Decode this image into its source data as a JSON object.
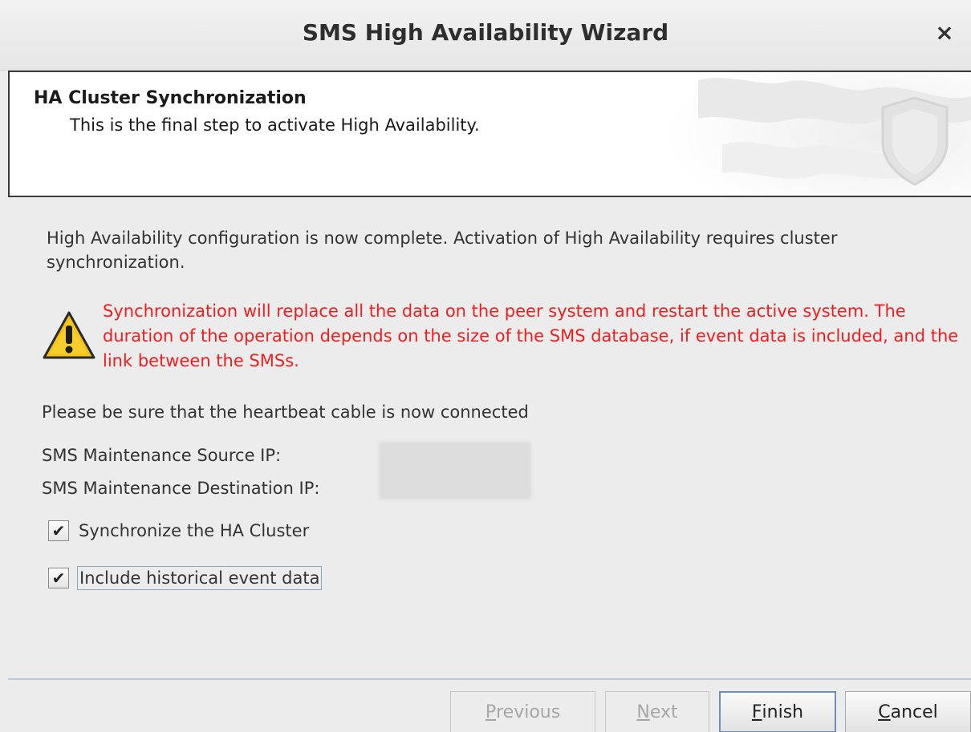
{
  "window": {
    "title": "SMS High Availability Wizard",
    "close_symbol": "×"
  },
  "header": {
    "heading": "HA Cluster Synchronization",
    "subheading": "This is the final step to activate High Availability."
  },
  "body": {
    "intro": "High Availability configuration is now complete.  Activation of High Availability requires cluster synchronization.",
    "warning_icon": "warning-triangle-icon",
    "warning": "Synchronization will replace all the data on the peer system and restart the active system.  The duration of the operation depends on the size of the SMS database, if event data is included, and the link between the SMSs.",
    "warning_color": "#f01e1e",
    "heartbeat_note": "Please be sure that the heartbeat cable is now connected",
    "source_ip_label": "SMS Maintenance Source IP:",
    "destination_ip_label": "SMS Maintenance Destination IP:"
  },
  "options": [
    {
      "label": "Synchronize the HA Cluster",
      "checked": true
    },
    {
      "label": "Include historical event data",
      "checked": true
    }
  ],
  "buttons": {
    "previous": {
      "mnemonic": "P",
      "rest": "revious",
      "enabled": false
    },
    "next": {
      "mnemonic": "N",
      "rest": "ext",
      "enabled": false
    },
    "finish": {
      "mnemonic": "F",
      "rest": "inish",
      "enabled": true
    },
    "cancel": {
      "mnemonic": "C",
      "rest": "ancel",
      "enabled": true
    }
  }
}
